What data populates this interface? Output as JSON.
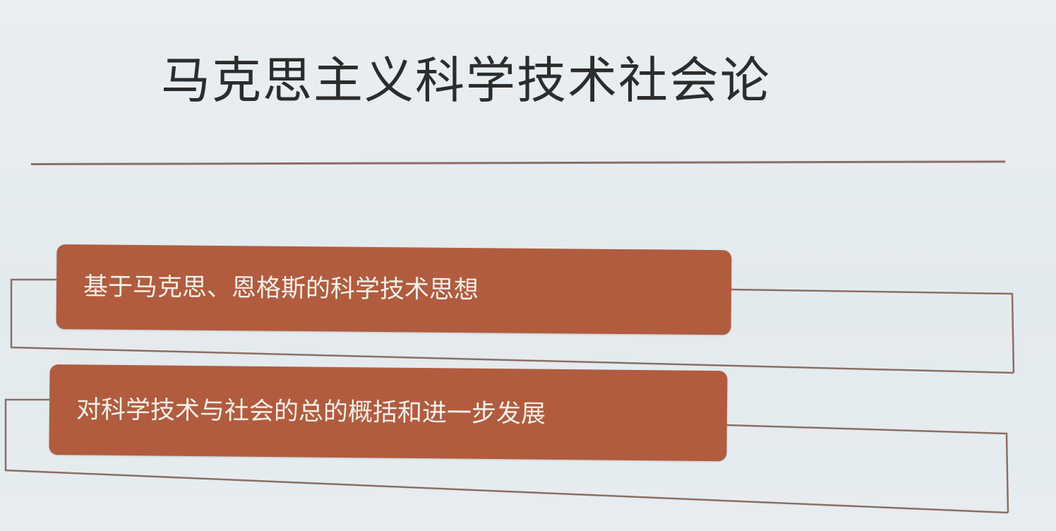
{
  "slide": {
    "title": "马克思主义科学技术社会论",
    "items": [
      {
        "label": "基于马克思、恩格斯的科学技术思想"
      },
      {
        "label": "对科学技术与社会的总的概括和进一步发展"
      }
    ]
  },
  "colors": {
    "background": "#e6ecef",
    "accent_box": "#b15c3e",
    "box_text": "#f6eee9",
    "line": "#8d6e64",
    "title_text": "#2c2c2c"
  }
}
